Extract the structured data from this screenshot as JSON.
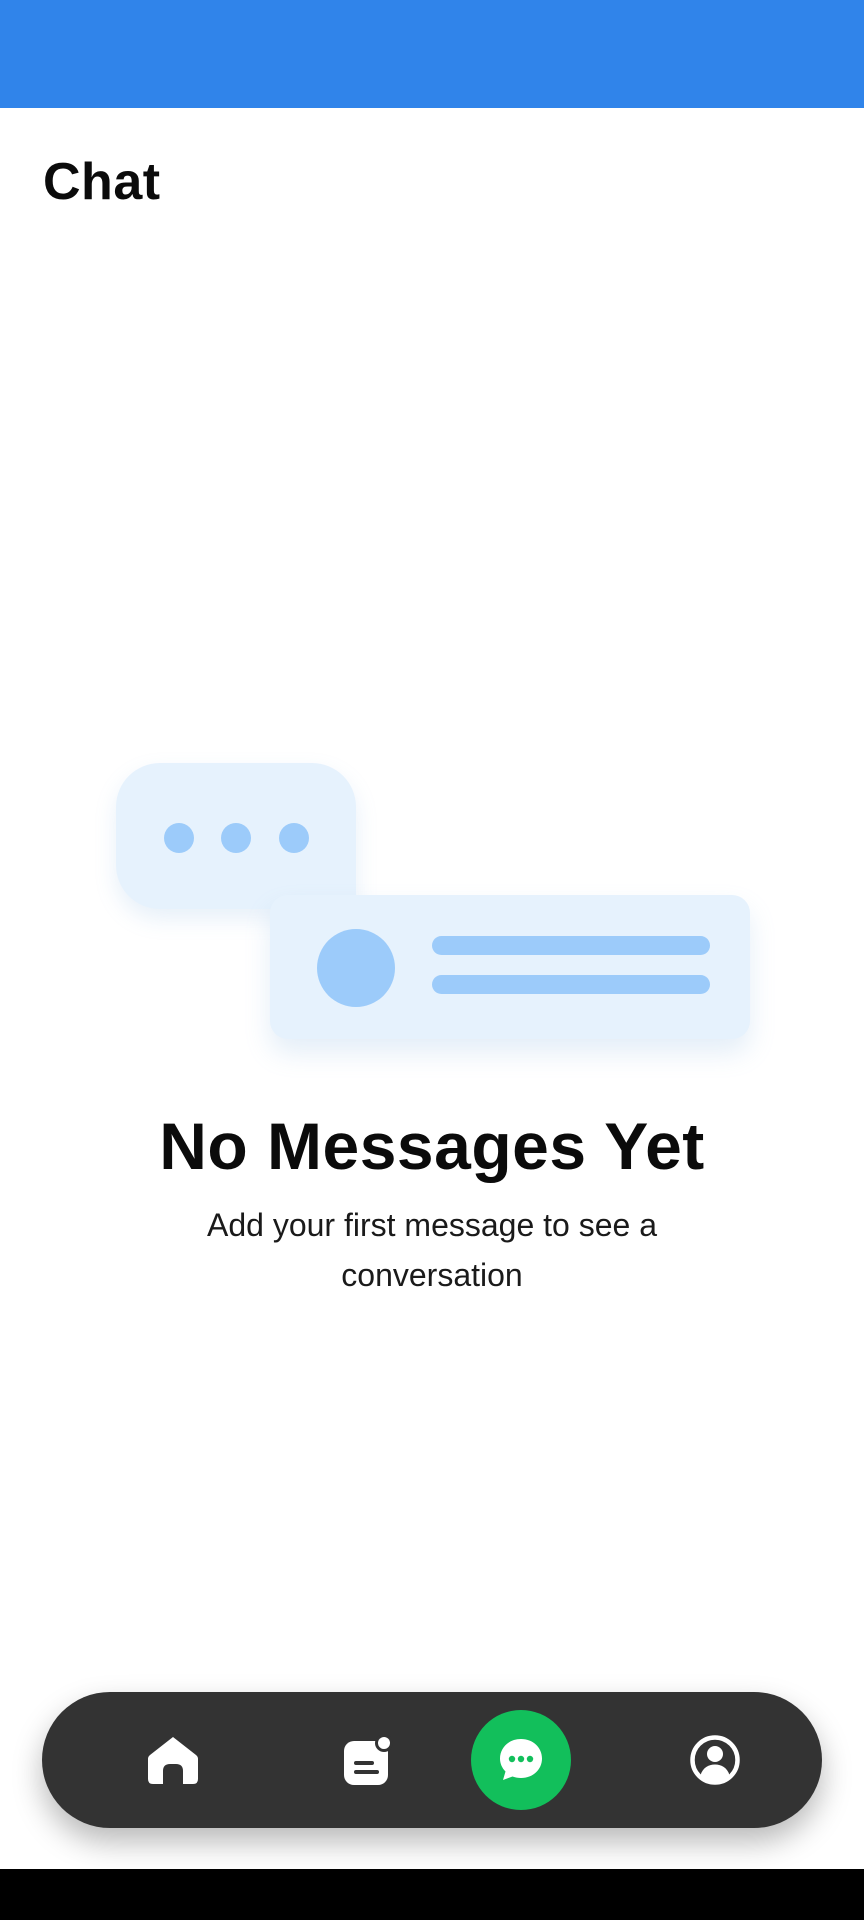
{
  "status_bar": {
    "color": "#3084ea"
  },
  "header": {
    "title": "Chat"
  },
  "empty_state": {
    "title": "No Messages Yet",
    "subtitle": "Add your first message to see a conversation",
    "illustration": "chat-bubbles-illustration"
  },
  "bottom_nav": {
    "items": [
      {
        "id": "home",
        "icon": "home-icon",
        "active": false
      },
      {
        "id": "notes",
        "icon": "notes-icon",
        "active": false
      },
      {
        "id": "chat",
        "icon": "chat-bubble-icon",
        "active": true
      },
      {
        "id": "profile",
        "icon": "profile-icon",
        "active": false
      }
    ],
    "active_color": "#12bf5b",
    "background": "#333333"
  }
}
